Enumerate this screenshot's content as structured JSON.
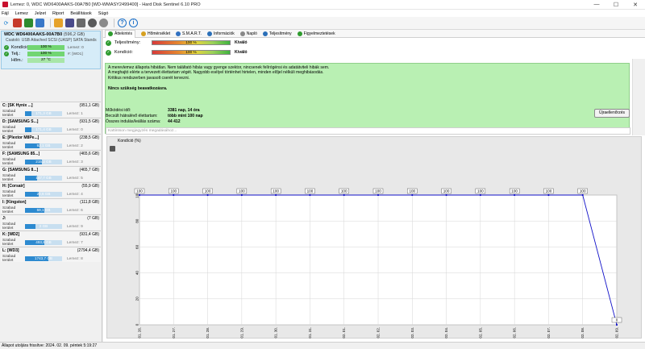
{
  "window": {
    "title": "Lemez: 0, WDC WD6400AAKS-00A7B0 [WD-WMASY2499400]  -  Hard Disk Sentinel 6.10 PRO",
    "minimize": "—",
    "maximize": "☐",
    "close": "✕"
  },
  "menu": [
    "Fájl",
    "Lemez",
    "Jelzet",
    "Riport",
    "Beállítások",
    "Súgó"
  ],
  "toolbar": [
    "refresh-icon",
    "disk-icon",
    "graph-icon",
    "copy-icon",
    "report-icon",
    "save-icon",
    "print-icon",
    "camera-icon",
    "config-icon",
    "help-icon",
    "info-icon"
  ],
  "disk": {
    "name": "WDC WD6400AAKS-00A7B0",
    "size": "(596,2 GB)",
    "connection": "Csatoló: USB Attached SCSI (UASP) SATA Stands",
    "rows": [
      {
        "label": "Kondíció:",
        "value": "100 %",
        "extra": "Lemez: 0"
      },
      {
        "label": "Telj.:",
        "value": "100 %",
        "extra": "#: [WD1]"
      },
      {
        "label": "Hőm.:",
        "value": "27 °C",
        "extra": ""
      }
    ]
  },
  "volumes": [
    {
      "name": "C: [SK Hynix ...]",
      "size": "(951,1 GB)",
      "free_label": "Szabad terület",
      "free": "171,3 GB",
      "fill": 0.18,
      "disk": "Lemez: 1"
    },
    {
      "name": "D: [SAMSUNG S...]",
      "size": "(931,5 GB)",
      "free_label": "Szabad terület",
      "free": "171,4 GB",
      "fill": 0.18,
      "disk": "Lemez: 0"
    },
    {
      "name": "E: [Plextor M8Pe...]",
      "size": "(238,5 GB)",
      "free_label": "Szabad terület",
      "free": "92,1 GB",
      "fill": 0.39,
      "disk": "Lemez: 2"
    },
    {
      "name": "F: [SAMSUNG 85...]",
      "size": "(465,6 GB)",
      "free_label": "Szabad terület",
      "free": "215,2 GB",
      "fill": 0.46,
      "disk": "Lemez: 3"
    },
    {
      "name": "G: [SAMSUNG 8...]",
      "size": "(465,7 GB)",
      "free_label": "Szabad terület",
      "free": "147,7 GB",
      "fill": 0.32,
      "disk": "Lemez: 5"
    },
    {
      "name": "H: [Corsair]",
      "size": "(55,9 GB)",
      "free_label": "Szabad terület",
      "free": "20,6 GB",
      "fill": 0.37,
      "disk": "Lemez: 4"
    },
    {
      "name": "I: [Kingston]",
      "size": "(111,8 GB)",
      "free_label": "Szabad terület",
      "free": "59,1 GB",
      "fill": 0.53,
      "disk": "Lemez: 6"
    },
    {
      "name": "J:",
      "size": "(7 GB)",
      "free_label": "Szabad terület",
      "free": "2 GB",
      "fill": 0.29,
      "disk": "Lemez: 9"
    },
    {
      "name": "K: [WD2]",
      "size": "(931,4 GB)",
      "free_label": "Szabad terület",
      "free": "493,8 GB",
      "fill": 0.53,
      "disk": "Lemez: 7"
    },
    {
      "name": "L: [WD3]",
      "size": "(2794,4 GB)",
      "free_label": "Szabad terület",
      "free": "1743,7 GB",
      "fill": 0.62,
      "disk": "Lemez: 8"
    }
  ],
  "tabs": [
    "Áttekintés",
    "Hőmérséklet",
    "S.M.A.R.T.",
    "Információk",
    "Napló",
    "Teljesítmény",
    "Figyelmeztetések"
  ],
  "tab_colors": [
    "#2e9b2e",
    "#d6a020",
    "#3070c0",
    "#2a6fb8",
    "#888888",
    "#2a6fb8",
    "#2e9b2e"
  ],
  "status": [
    {
      "label": "Teljesítmény:",
      "value": "100 %",
      "rating": "Kiváló"
    },
    {
      "label": "Kondíció:",
      "value": "100 %",
      "rating": "Kiváló"
    }
  ],
  "message": {
    "lines": [
      "A merevlemez állapota hibátlan. Nem találtató hibás vagy gyenge szektor, nincsenek felírógénsi és adatátviteli hibák sem.",
      "A meghajtó elérte a tervezett élettartam végét. Nagyobb esélyel történhet hirtelen, minden előjel nélküli meghibásodás.",
      "Kritikus rendszerben javasolt cserét tervezni."
    ],
    "note": "Nincs szükség beavatkozásra."
  },
  "info": [
    {
      "k": "Működési idő:",
      "v": "3381 nap, 14 óra"
    },
    {
      "k": "Becsült hátralévő élettartam:",
      "v": "több mint 100 nap"
    },
    {
      "k": "Összes indulás/leállás száma:",
      "v": "44 412"
    }
  ],
  "refresh_label": "Újraellenőrzés",
  "comment_placeholder": "Kattintson megjegyzés megadásához...",
  "chart_title": "Kondíció  (%)",
  "chart_data": {
    "type": "line",
    "title": "Kondíció  (%)",
    "ylim": [
      0,
      100
    ],
    "yticks": [
      0,
      20,
      40,
      60,
      80,
      100
    ],
    "x": [
      "2024. 01. 26.",
      "2024. 01. 27.",
      "2024. 01. 28.",
      "2024. 01. 29.",
      "2024. 01. 30.",
      "2024. 01. 31.",
      "2024. 02. 01.",
      "2024. 02. 02.",
      "2024. 02. 03.",
      "2024. 02. 04.",
      "2024. 02. 05.",
      "2024. 02. 06.",
      "2024. 02. 07.",
      "2024. 02. 08.",
      "2024. 02. 09."
    ],
    "series": [
      {
        "values": [
          100,
          100,
          100,
          100,
          100,
          100,
          100,
          100,
          100,
          100,
          100,
          100,
          100,
          100,
          0
        ]
      }
    ],
    "labels": [
      "100",
      "100",
      "100",
      "100",
      "100",
      "100",
      "100",
      "100",
      "100",
      "100",
      "100",
      "100",
      "100",
      "100",
      "0"
    ],
    "grid": true
  },
  "statusbar": "Állapot utoljára frissítve: 2024. 02. 09. péntek 5:19:27"
}
